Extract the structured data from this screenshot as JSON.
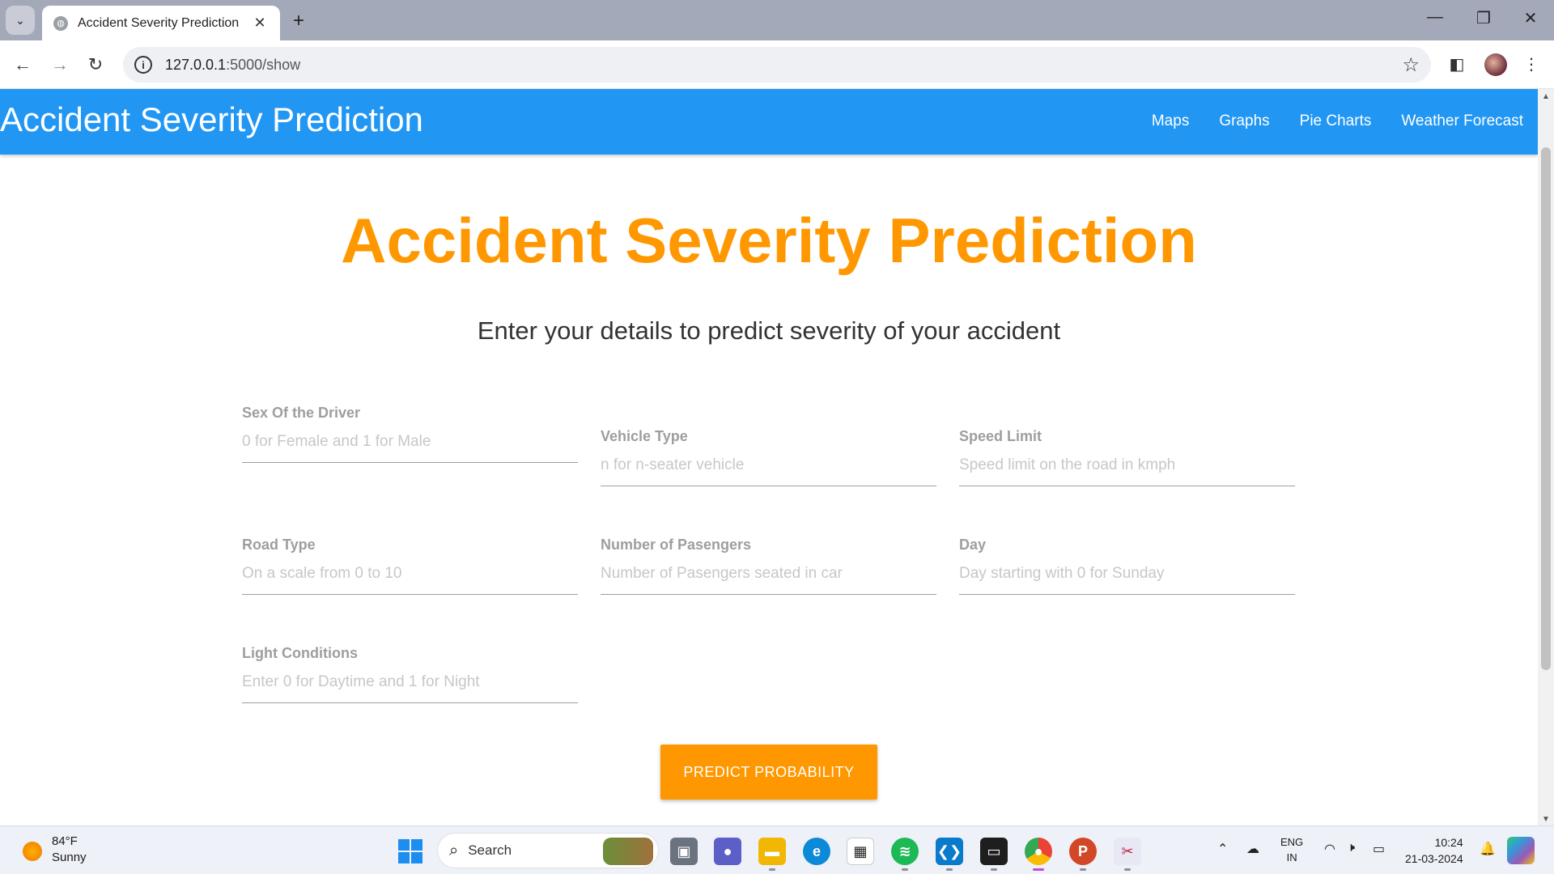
{
  "browser": {
    "tab_title": "Accident Severity Prediction",
    "url_host": "127.0.0.1",
    "url_path": ":5000/show"
  },
  "navbar": {
    "brand": "Accident Severity Prediction",
    "links": [
      "Maps",
      "Graphs",
      "Pie Charts",
      "Weather Forecast"
    ]
  },
  "page": {
    "heading": "Accident Severity Prediction",
    "subheading": "Enter your details to predict severity of your accident"
  },
  "form": {
    "fields": [
      {
        "label": "Sex Of the Driver",
        "placeholder": "0 for Female and 1 for Male"
      },
      {
        "label": "Vehicle Type",
        "placeholder": "n for n-seater vehicle"
      },
      {
        "label": "Speed Limit",
        "placeholder": "Speed limit on the road in kmph"
      },
      {
        "label": "Road Type",
        "placeholder": "On a scale from 0 to 10"
      },
      {
        "label": "Number of Pasengers",
        "placeholder": "Number of Pasengers seated in car"
      },
      {
        "label": "Day",
        "placeholder": "Day starting with 0 for Sunday"
      },
      {
        "label": "Light Conditions",
        "placeholder": "Enter 0 for Daytime and 1 for Night"
      }
    ],
    "submit_label": "PREDICT PROBABILITY"
  },
  "taskbar": {
    "weather_temp": "84°F",
    "weather_desc": "Sunny",
    "search_label": "Search",
    "lang_line1": "ENG",
    "lang_line2": "IN",
    "time": "10:24",
    "date": "21-03-2024"
  },
  "colors": {
    "navbar": "#2196f3",
    "accent": "#ff9800",
    "label": "#9e9e9e"
  }
}
